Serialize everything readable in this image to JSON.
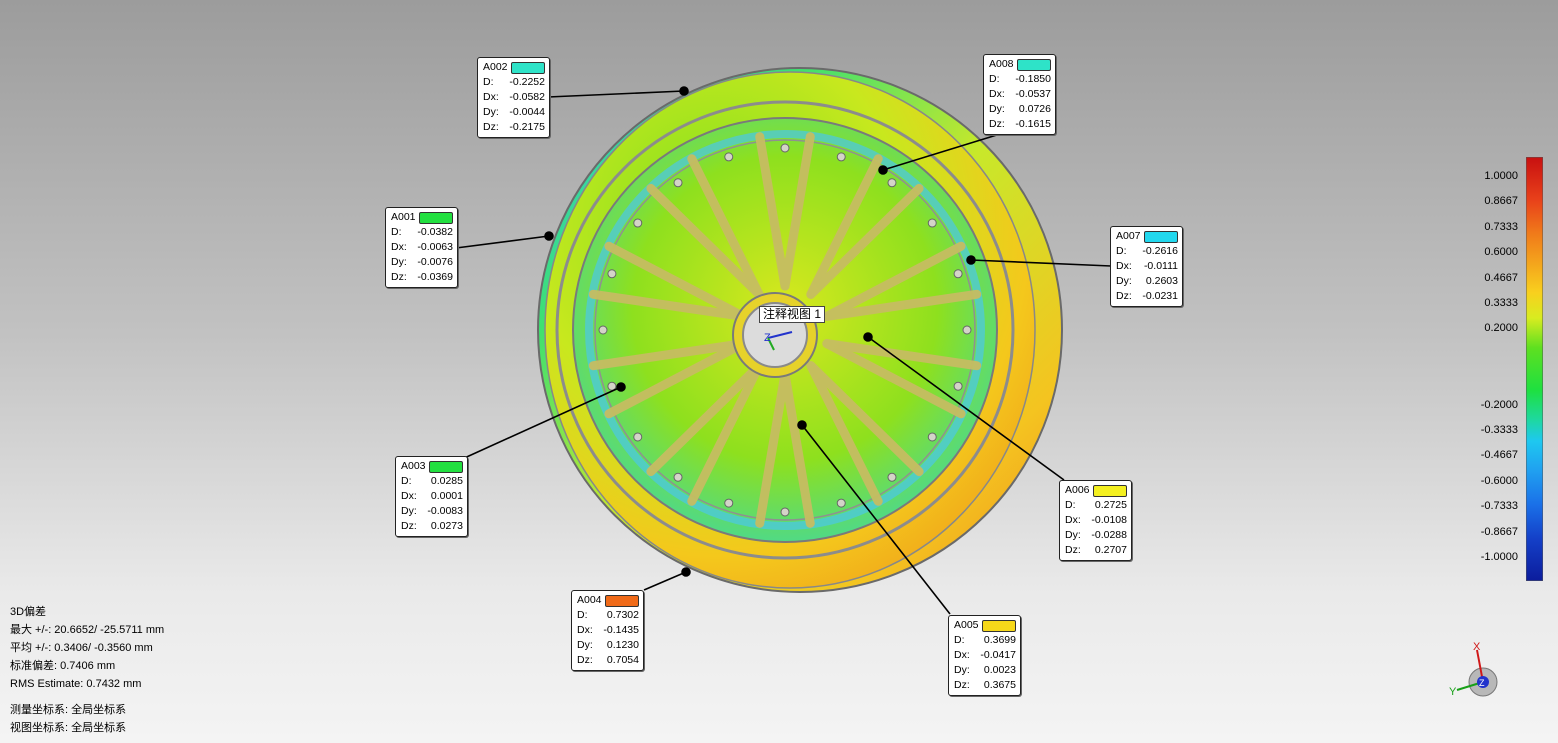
{
  "view_label": "注释视图 1",
  "center_axis_label": "Z",
  "callouts": [
    {
      "id": "A002",
      "color": "#2ee3c8",
      "rows": [
        [
          "D:",
          "-0.2252"
        ],
        [
          "Dx:",
          "-0.0582"
        ],
        [
          "Dy:",
          "-0.0044"
        ],
        [
          "Dz:",
          "-0.2175"
        ]
      ]
    },
    {
      "id": "A008",
      "color": "#2ee3c8",
      "rows": [
        [
          "D:",
          "-0.1850"
        ],
        [
          "Dx:",
          "-0.0537"
        ],
        [
          "Dy:",
          "0.0726"
        ],
        [
          "Dz:",
          "-0.1615"
        ]
      ]
    },
    {
      "id": "A001",
      "color": "#22e040",
      "rows": [
        [
          "D:",
          "-0.0382"
        ],
        [
          "Dx:",
          "-0.0063"
        ],
        [
          "Dy:",
          "-0.0076"
        ],
        [
          "Dz:",
          "-0.0369"
        ]
      ]
    },
    {
      "id": "A007",
      "color": "#22d8ee",
      "rows": [
        [
          "D:",
          "-0.2616"
        ],
        [
          "Dx:",
          "-0.0111"
        ],
        [
          "Dy:",
          "0.2603"
        ],
        [
          "Dz:",
          "-0.0231"
        ]
      ]
    },
    {
      "id": "A003",
      "color": "#22e040",
      "rows": [
        [
          "D:",
          "0.0285"
        ],
        [
          "Dx:",
          "0.0001"
        ],
        [
          "Dy:",
          "-0.0083"
        ],
        [
          "Dz:",
          "0.0273"
        ]
      ]
    },
    {
      "id": "A006",
      "color": "#f4f020",
      "rows": [
        [
          "D:",
          "0.2725"
        ],
        [
          "Dx:",
          "-0.0108"
        ],
        [
          "Dy:",
          "-0.0288"
        ],
        [
          "Dz:",
          "0.2707"
        ]
      ]
    },
    {
      "id": "A004",
      "color": "#f06a18",
      "rows": [
        [
          "D:",
          "0.7302"
        ],
        [
          "Dx:",
          "-0.1435"
        ],
        [
          "Dy:",
          "0.1230"
        ],
        [
          "Dz:",
          "0.7054"
        ]
      ]
    },
    {
      "id": "A005",
      "color": "#f6d81a",
      "rows": [
        [
          "D:",
          "0.3699"
        ],
        [
          "Dx:",
          "-0.0417"
        ],
        [
          "Dy:",
          "0.0023"
        ],
        [
          "Dz:",
          "0.3675"
        ]
      ]
    }
  ],
  "legend": {
    "ticks": [
      "1.0000",
      "0.8667",
      "0.7333",
      "0.6000",
      "0.4667",
      "0.3333",
      "0.2000",
      "-0.2000",
      "-0.3333",
      "-0.4667",
      "-0.6000",
      "-0.7333",
      "-0.8667",
      "-1.0000"
    ],
    "colors": [
      "#c81010",
      "#e8401a",
      "#f07a1a",
      "#f4a41c",
      "#f8d01e",
      "#d8ec20",
      "#1ee040",
      "#1ed8a0",
      "#1ec8f0",
      "#20a0f0",
      "#1a70e8",
      "#1440c8",
      "#0c1c9c"
    ]
  },
  "stats": {
    "title": "3D偏差",
    "max": "最大 +/-: 20.6652/ -25.5711 mm",
    "avg": "平均 +/-: 0.3406/ -0.3560 mm",
    "std": "标准偏差: 0.7406 mm",
    "rms": "RMS Estimate: 0.7432 mm",
    "measure_cs": "测量坐标系: 全局坐标系",
    "view_cs": "视图坐标系: 全局坐标系"
  },
  "triad": {
    "x_label": "X",
    "y_label": "Y",
    "z_label": "Z"
  }
}
